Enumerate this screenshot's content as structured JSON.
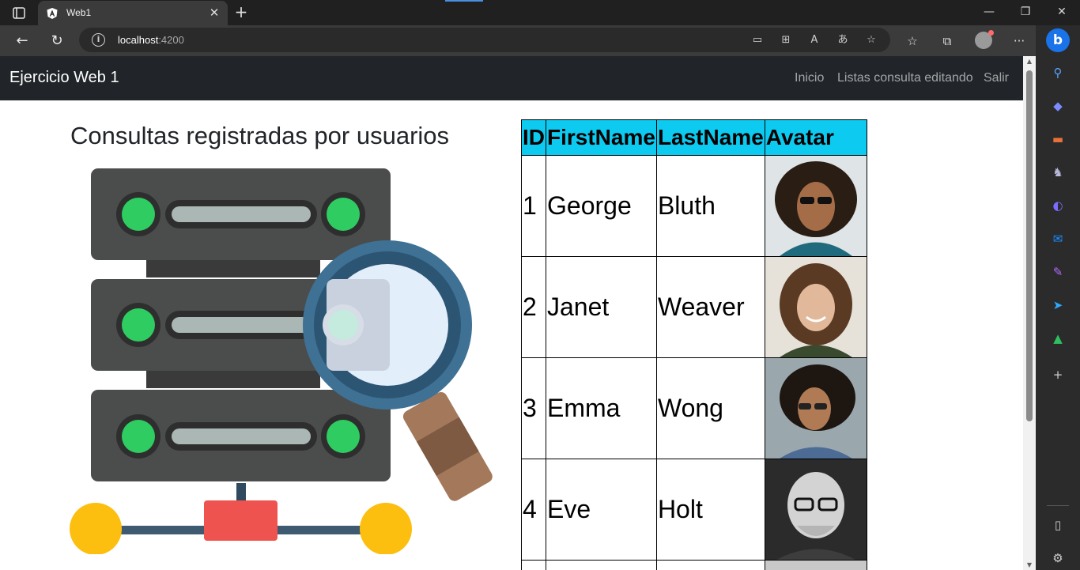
{
  "browser": {
    "tab": {
      "title": "Web1",
      "favicon": "angular-icon"
    },
    "address": {
      "host": "localhost",
      "port": ":4200"
    },
    "window_controls": [
      "minimize",
      "restore",
      "close"
    ]
  },
  "page": {
    "navbar": {
      "brand": "Ejercicio Web 1",
      "links": [
        "Inicio",
        "Listas consulta editando",
        "Salir"
      ]
    },
    "heading": "Consultas registradas por usuarios",
    "table": {
      "headers": [
        "ID",
        "FirstName",
        "LastName",
        "Avatar"
      ],
      "rows": [
        {
          "id": "1",
          "first": "George",
          "last": "Bluth"
        },
        {
          "id": "2",
          "first": "Janet",
          "last": "Weaver"
        },
        {
          "id": "3",
          "first": "Emma",
          "last": "Wong"
        },
        {
          "id": "4",
          "first": "Eve",
          "last": "Holt"
        }
      ]
    }
  },
  "colors": {
    "navbar_bg": "#212529",
    "table_header_bg": "#0dcaf0",
    "browser_chrome": "#3b3b3b"
  }
}
